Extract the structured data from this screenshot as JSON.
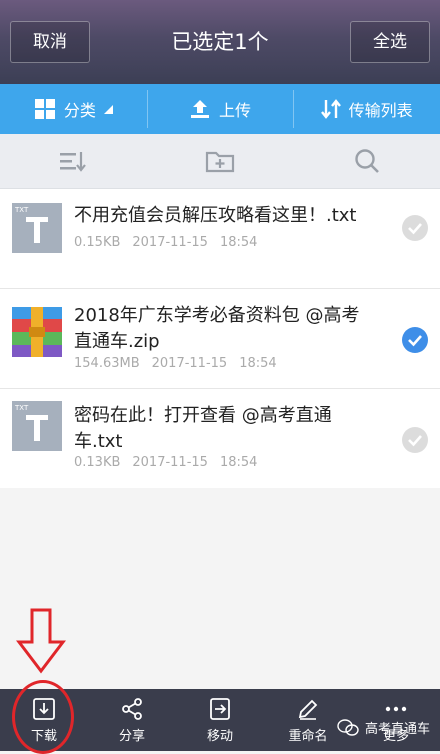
{
  "header": {
    "cancel_label": "取消",
    "title": "已选定1个",
    "select_all_label": "全选"
  },
  "toolbar": {
    "category_label": "分类",
    "upload_label": "上传",
    "transfer_label": "传输列表",
    "color": "#3ea6ec"
  },
  "actions": {
    "icons": [
      "sort-icon",
      "new-folder-icon",
      "search-icon"
    ]
  },
  "files": [
    {
      "name": "不用充值会员解压攻略看这里！.txt",
      "size": "0.15KB",
      "date": "2017-11-15",
      "time": "18:54",
      "type": "txt",
      "type_label": "TXT",
      "selected": false
    },
    {
      "name": "2018年广东学考必备资料包 @高考直通车.zip",
      "size": "154.63MB",
      "date": "2017-11-15",
      "time": "18:54",
      "type": "zip",
      "selected": true
    },
    {
      "name": "密码在此！打开查看 @高考直通车.txt",
      "size": "0.13KB",
      "date": "2017-11-15",
      "time": "18:54",
      "type": "txt",
      "type_label": "TXT",
      "selected": false
    }
  ],
  "bottom_bar": {
    "download_label": "下载",
    "share_label": "分享",
    "move_label": "移动",
    "rename_label": "重命名",
    "more_label": "更多"
  },
  "watermark": {
    "text": "高考直通车"
  },
  "annotation_color": "#e0262a"
}
